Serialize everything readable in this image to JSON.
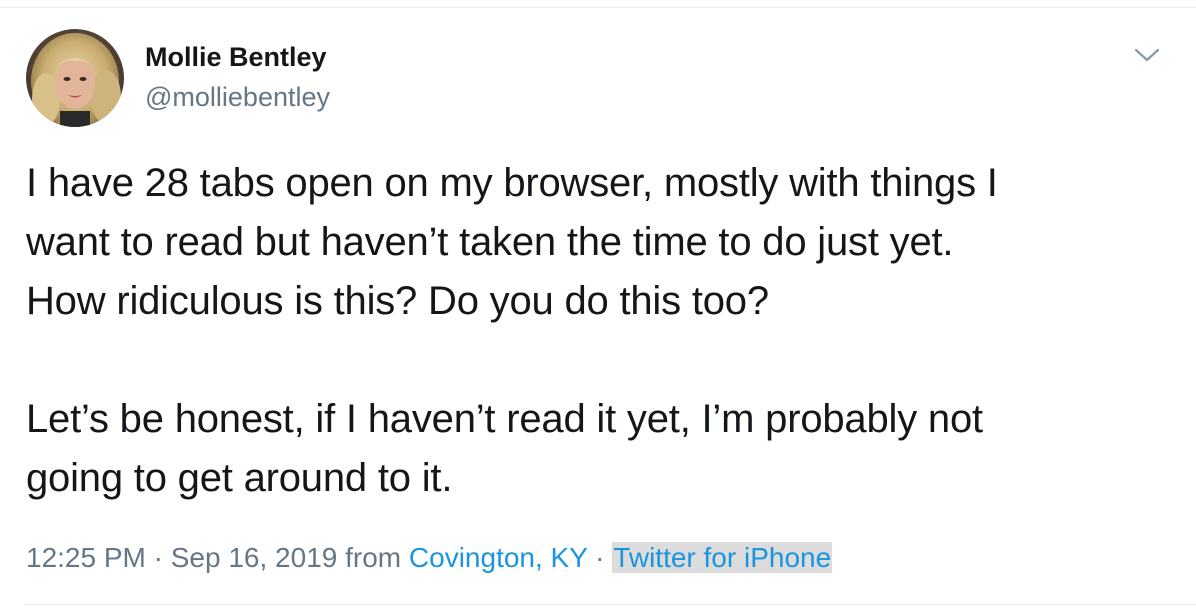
{
  "tweet": {
    "author": {
      "display_name": "Mollie Bentley",
      "username": "@molliebentley",
      "avatar_icon": "profile-photo"
    },
    "text_lines": [
      "I have 28 tabs open on my browser, mostly with things I",
      "want to read but haven’t taken the time to do just yet.",
      "How ridiculous is this? Do you do this too?",
      "Let’s be honest, if I haven’t read it yet, I’m probably not",
      "going to get around to it."
    ],
    "meta": {
      "time": "12:25 PM",
      "separator": " · ",
      "date": "Sep 16, 2019",
      "from_label": " from ",
      "location": "Covington, KY",
      "source": "Twitter for iPhone"
    }
  },
  "colors": {
    "text": "#14171a",
    "secondary": "#657786",
    "link": "#1b95e0",
    "highlight": "#dcdcdc",
    "border": "#e6ecf0"
  }
}
